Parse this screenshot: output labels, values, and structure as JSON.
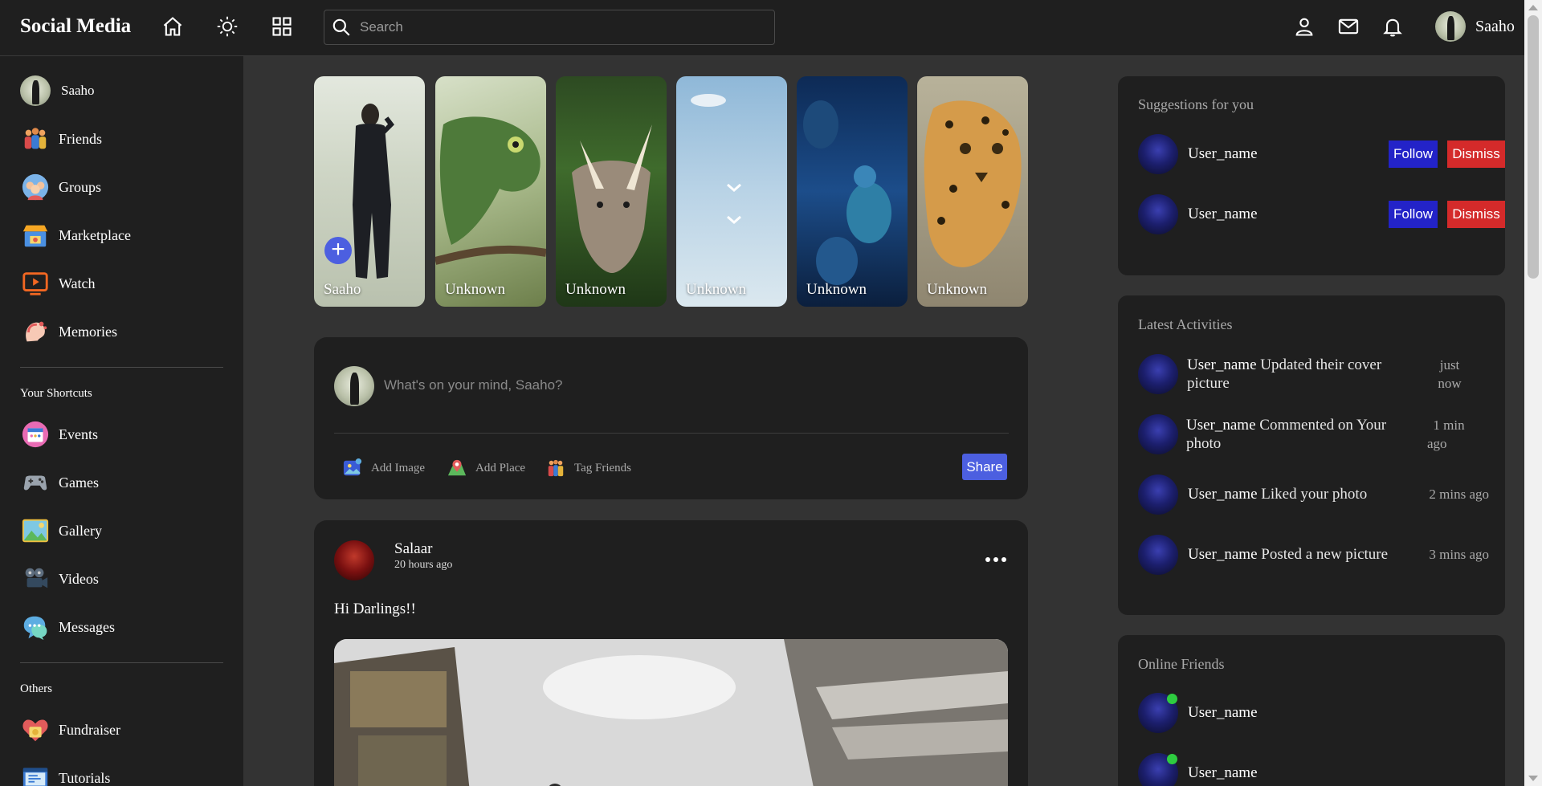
{
  "topbar": {
    "brand": "Social Media",
    "search_placeholder": "Search",
    "user_name": "Saaho"
  },
  "sidebar": {
    "profile": "Saaho",
    "main_items": [
      {
        "label": "Friends",
        "icon": "friends-icon"
      },
      {
        "label": "Groups",
        "icon": "groups-icon"
      },
      {
        "label": "Marketplace",
        "icon": "marketplace-icon"
      },
      {
        "label": "Watch",
        "icon": "watch-icon"
      },
      {
        "label": "Memories",
        "icon": "memories-icon"
      }
    ],
    "shortcuts_heading": "Your Shortcuts",
    "shortcuts": [
      {
        "label": "Events",
        "icon": "events-icon"
      },
      {
        "label": "Games",
        "icon": "games-icon"
      },
      {
        "label": "Gallery",
        "icon": "gallery-icon"
      },
      {
        "label": "Videos",
        "icon": "videos-icon"
      },
      {
        "label": "Messages",
        "icon": "messages-icon"
      }
    ],
    "others_heading": "Others",
    "others": [
      {
        "label": "Fundraiser",
        "icon": "fundraiser-icon"
      },
      {
        "label": "Tutorials",
        "icon": "tutorials-icon"
      }
    ]
  },
  "stories": [
    {
      "name": "Saaho",
      "subject": "man-in-coat"
    },
    {
      "name": "Unknown",
      "subject": "chameleon"
    },
    {
      "name": "Unknown",
      "subject": "dinosaur"
    },
    {
      "name": "Unknown",
      "subject": "birds-in-sky"
    },
    {
      "name": "Unknown",
      "subject": "pigeons"
    },
    {
      "name": "Unknown",
      "subject": "leopard"
    }
  ],
  "composer": {
    "placeholder": "What's on your mind, Saaho?",
    "add_image": "Add Image",
    "add_place": "Add Place",
    "tag_friends": "Tag Friends",
    "share": "Share"
  },
  "post": {
    "author": "Salaar",
    "time": "20 hours ago",
    "text": "Hi Darlings!!"
  },
  "suggestions": {
    "title": "Suggestions for you",
    "items": [
      {
        "name": "User_name",
        "follow": "Follow",
        "dismiss": "Dismiss"
      },
      {
        "name": "User_name",
        "follow": "Follow",
        "dismiss": "Dismiss"
      }
    ]
  },
  "activities": {
    "title": "Latest Activities",
    "items": [
      {
        "user": "User_name",
        "text": "Updated their cover picture",
        "time_line1": "just",
        "time_line2": "now"
      },
      {
        "user": "User_name",
        "text": "Commented on Your photo",
        "time_line1": "1 min",
        "time_line2": "ago"
      },
      {
        "user": "User_name",
        "text": "Liked your photo",
        "time_line1": "2 mins ago",
        "time_line2": ""
      },
      {
        "user": "User_name",
        "text": "Posted a new picture",
        "time_line1": "3 mins ago",
        "time_line2": ""
      }
    ]
  },
  "online": {
    "title": "Online Friends",
    "items": [
      {
        "name": "User_name"
      },
      {
        "name": "User_name"
      }
    ]
  },
  "colors": {
    "accent": "#4c5fe0",
    "follow": "#2323c8",
    "dismiss": "#d42a2a",
    "online": "#2ecc40",
    "panel_bg": "#1f1f1f",
    "page_bg": "#333333"
  }
}
